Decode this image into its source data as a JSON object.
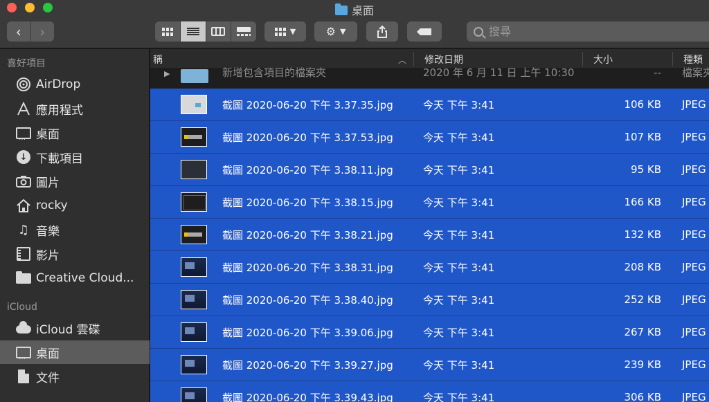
{
  "window": {
    "title": "桌面"
  },
  "toolbar": {
    "back_glyph": "‹",
    "forward_glyph": "›",
    "search_placeholder": "搜尋"
  },
  "sidebar": {
    "section_favorites": "喜好項目",
    "section_icloud": "iCloud",
    "items": [
      {
        "label": "AirDrop",
        "icon": "airdrop-icon"
      },
      {
        "label": "應用程式",
        "icon": "applications-icon"
      },
      {
        "label": "桌面",
        "icon": "desktop-icon"
      },
      {
        "label": "下載項目",
        "icon": "downloads-icon"
      },
      {
        "label": "圖片",
        "icon": "pictures-icon"
      },
      {
        "label": "rocky",
        "icon": "home-icon"
      },
      {
        "label": "音樂",
        "icon": "music-icon"
      },
      {
        "label": "影片",
        "icon": "movies-icon"
      },
      {
        "label": "Creative Cloud...",
        "icon": "folder-icon"
      }
    ],
    "icloud_items": [
      {
        "label": "iCloud 雲碟",
        "icon": "icloud-drive-icon"
      },
      {
        "label": "桌面",
        "icon": "desktop-icon",
        "selected": true
      },
      {
        "label": "文件",
        "icon": "documents-icon"
      }
    ]
  },
  "columns": {
    "name": "稱",
    "date": "修改日期",
    "size": "大小",
    "kind": "種類"
  },
  "folder_row": {
    "name": "新增包含項目的檔案夾",
    "date": "2020 年 6 月 11 日 上午 10:30",
    "size": "--",
    "kind": "檔案夾"
  },
  "files": [
    {
      "name": "截圖 2020-06-20 下午 3.37.35.jpg",
      "date": "今天 下午 3:41",
      "size": "106 KB",
      "kind": "JPEG",
      "thumb": "light"
    },
    {
      "name": "截圖 2020-06-20 下午 3.37.53.jpg",
      "date": "今天 下午 3:41",
      "size": "107 KB",
      "kind": "JPEG",
      "thumb": "warn"
    },
    {
      "name": "截圖 2020-06-20 下午 3.38.11.jpg",
      "date": "今天 下午 3:41",
      "size": "95 KB",
      "kind": "JPEG",
      "thumb": "dark"
    },
    {
      "name": "截圖 2020-06-20 下午 3.38.15.jpg",
      "date": "今天 下午 3:41",
      "size": "166 KB",
      "kind": "JPEG",
      "thumb": "win"
    },
    {
      "name": "截圖 2020-06-20 下午 3.38.21.jpg",
      "date": "今天 下午 3:41",
      "size": "132 KB",
      "kind": "JPEG",
      "thumb": "warn"
    },
    {
      "name": "截圖 2020-06-20 下午 3.38.31.jpg",
      "date": "今天 下午 3:41",
      "size": "208 KB",
      "kind": "JPEG",
      "thumb": "game"
    },
    {
      "name": "截圖 2020-06-20 下午 3.38.40.jpg",
      "date": "今天 下午 3:41",
      "size": "252 KB",
      "kind": "JPEG",
      "thumb": "game"
    },
    {
      "name": "截圖 2020-06-20 下午 3.39.06.jpg",
      "date": "今天 下午 3:41",
      "size": "267 KB",
      "kind": "JPEG",
      "thumb": "game"
    },
    {
      "name": "截圖 2020-06-20 下午 3.39.27.jpg",
      "date": "今天 下午 3:41",
      "size": "239 KB",
      "kind": "JPEG",
      "thumb": "game"
    },
    {
      "name": "截圖 2020-06-20 下午 3.39.43.jpg",
      "date": "今天 下午 3:41",
      "size": "306 KB",
      "kind": "JPEG",
      "thumb": "game"
    }
  ],
  "colors": {
    "selection": "#2057c8",
    "sidebar_bg": "#2f2f2f",
    "toolbar_bg": "#3a3a3a"
  }
}
